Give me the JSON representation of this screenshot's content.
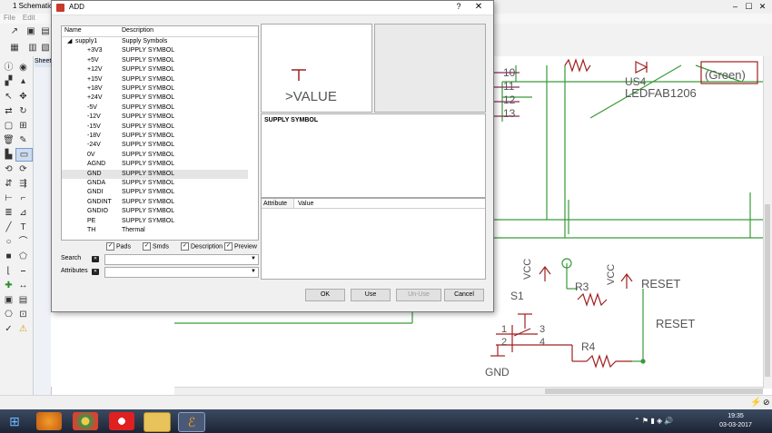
{
  "app": {
    "title": "1 Schematic",
    "menu": [
      "File",
      "Edit"
    ],
    "controls": [
      "–",
      "☐",
      "✕"
    ]
  },
  "sheets_tab": "Sheet",
  "dialog": {
    "title": "ADD",
    "help": "?",
    "close": "✕",
    "columns": {
      "name": "Name",
      "description": "Description"
    },
    "rows": [
      {
        "name": "supply1",
        "desc": "Supply Symbols",
        "expanded": true
      },
      {
        "name": "+3V3",
        "desc": "SUPPLY SYMBOL"
      },
      {
        "name": "+5V",
        "desc": "SUPPLY SYMBOL"
      },
      {
        "name": "+12V",
        "desc": "SUPPLY SYMBOL"
      },
      {
        "name": "+15V",
        "desc": "SUPPLY SYMBOL"
      },
      {
        "name": "+18V",
        "desc": "SUPPLY SYMBOL"
      },
      {
        "name": "+24V",
        "desc": "SUPPLY SYMBOL"
      },
      {
        "name": "-5V",
        "desc": "SUPPLY SYMBOL"
      },
      {
        "name": "-12V",
        "desc": "SUPPLY SYMBOL"
      },
      {
        "name": "-15V",
        "desc": "SUPPLY SYMBOL"
      },
      {
        "name": "-18V",
        "desc": "SUPPLY SYMBOL"
      },
      {
        "name": "-24V",
        "desc": "SUPPLY SYMBOL"
      },
      {
        "name": "0V",
        "desc": "SUPPLY SYMBOL"
      },
      {
        "name": "AGND",
        "desc": "SUPPLY SYMBOL"
      },
      {
        "name": "GND",
        "desc": "SUPPLY SYMBOL",
        "selected": true
      },
      {
        "name": "GNDA",
        "desc": "SUPPLY SYMBOL"
      },
      {
        "name": "GNDI",
        "desc": "SUPPLY SYMBOL"
      },
      {
        "name": "GNDINT",
        "desc": "SUPPLY SYMBOL"
      },
      {
        "name": "GNDIO",
        "desc": "SUPPLY SYMBOL"
      },
      {
        "name": "PE",
        "desc": "SUPPLY SYMBOL"
      },
      {
        "name": "TH",
        "desc": "Thermal"
      }
    ],
    "checks": {
      "pads": "Pads",
      "smds": "Smds",
      "description": "Description",
      "preview": "Preview"
    },
    "search_label": "Search",
    "attributes_label": "Attributes",
    "preview_text": ">VALUE",
    "description_text": "SUPPLY SYMBOL",
    "attr_columns": {
      "attribute": "Attribute",
      "value": "Value"
    },
    "buttons": {
      "ok": "OK",
      "use": "Use",
      "unuse": "Un-Use",
      "cancel": "Cancel"
    }
  },
  "schematic": {
    "pins": [
      "10",
      "11",
      "12",
      "13"
    ],
    "led_name": "US4",
    "led_value": "LEDFAB1206",
    "green_label": "(Green)",
    "vcc1": "VCC",
    "vcc2": "VCC",
    "r3": "R3",
    "reset1": "RESET",
    "reset2": "RESET",
    "s1": "S1",
    "s1_pins": [
      "1",
      "3",
      "2",
      "4"
    ],
    "r4": "R4",
    "gnd": "GND"
  },
  "clock": {
    "time": "19:35",
    "date": "03-03-2017"
  },
  "colors": {
    "wire": "#3a9a3a",
    "part": "#a02020",
    "text": "#555555",
    "bus": "#8a2a5a"
  }
}
